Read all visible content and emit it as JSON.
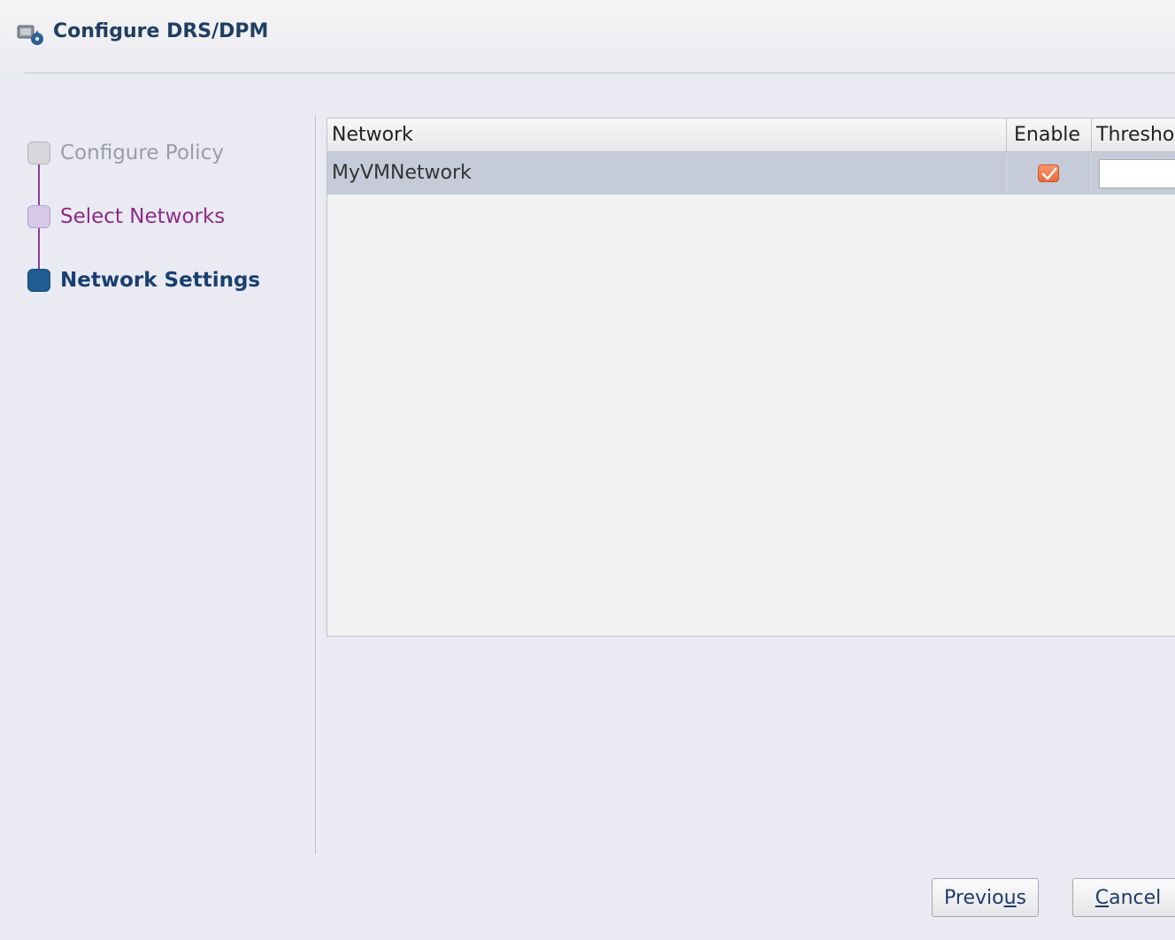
{
  "window": {
    "title": "Configure DRS/DPM"
  },
  "steps": [
    {
      "label": "Configure Policy",
      "state": "inactive"
    },
    {
      "label": "Select Networks",
      "state": "completed"
    },
    {
      "label": "Network Settings",
      "state": "current"
    }
  ],
  "table": {
    "columns": [
      "Network",
      "Enable",
      "Thresho"
    ],
    "rows": [
      {
        "network": "MyVMNetwork",
        "enabled": true,
        "threshold": ""
      }
    ]
  },
  "buttons": {
    "previous": {
      "before": "Previo",
      "mnemonic": "u",
      "after": "s"
    },
    "cancel": {
      "before": "",
      "mnemonic": "C",
      "after": "ancel"
    }
  },
  "colors": {
    "background": "#eaeaf2",
    "title": "#1f3e64",
    "step_inactive": "#9a9da4",
    "step_completed": "#8b2b88",
    "step_current": "#183f71",
    "selected_row": "#c5cbd8",
    "checkbox": "#e86b3c"
  },
  "icons": {
    "title": "vm-config-icon",
    "enable_checkbox": "checkmark-icon"
  }
}
